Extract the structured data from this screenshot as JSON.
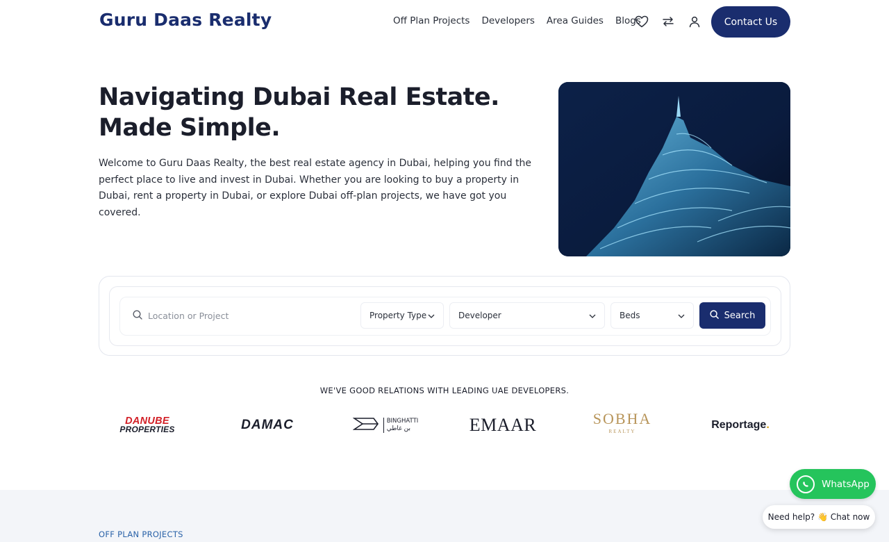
{
  "brand": {
    "name": "Guru Daas Realty",
    "primary_color": "#1a2d6e"
  },
  "nav": {
    "items": [
      {
        "label": "Off Plan Projects"
      },
      {
        "label": "Developers"
      },
      {
        "label": "Area Guides"
      },
      {
        "label": "Blogs"
      }
    ],
    "icons": [
      "heart-icon",
      "compare-arrows-icon",
      "user-icon"
    ],
    "contact_label": "Contact Us"
  },
  "hero": {
    "title": "Navigating Dubai Real Estate. Made Simple.",
    "description": "Welcome to Guru Daas Realty, the best real estate agency in Dubai, helping you find the perfect place to live and invest in Dubai. Whether you are looking to buy a property in Dubai, rent a property in Dubai, or explore Dubai off-plan projects, we have got you covered."
  },
  "search": {
    "placeholder": "Location or Project",
    "property_type": "Property Type",
    "developer": "Developer",
    "beds": "Beds",
    "button_label": "Search"
  },
  "developers": {
    "heading": "WE'VE GOOD RELATIONS WITH LEADING UAE DEVELOPERS.",
    "logos": [
      {
        "line1": "DANUBE",
        "line2": "PROPERTIES"
      },
      {
        "text": "DAMAC"
      },
      {
        "text": "BINGHATTI",
        "arabic": "بن غاطي"
      },
      {
        "text": "EMAAR"
      },
      {
        "text": "SOBHA",
        "sub": "REALTY"
      },
      {
        "text": "Reportage",
        "dot": "."
      }
    ]
  },
  "section": {
    "label": "OFF PLAN PROJECTS"
  },
  "whatsapp": {
    "label": "WhatsApp",
    "color": "#25c45c"
  },
  "chat": {
    "text": "Need help? 👋 Chat now"
  }
}
